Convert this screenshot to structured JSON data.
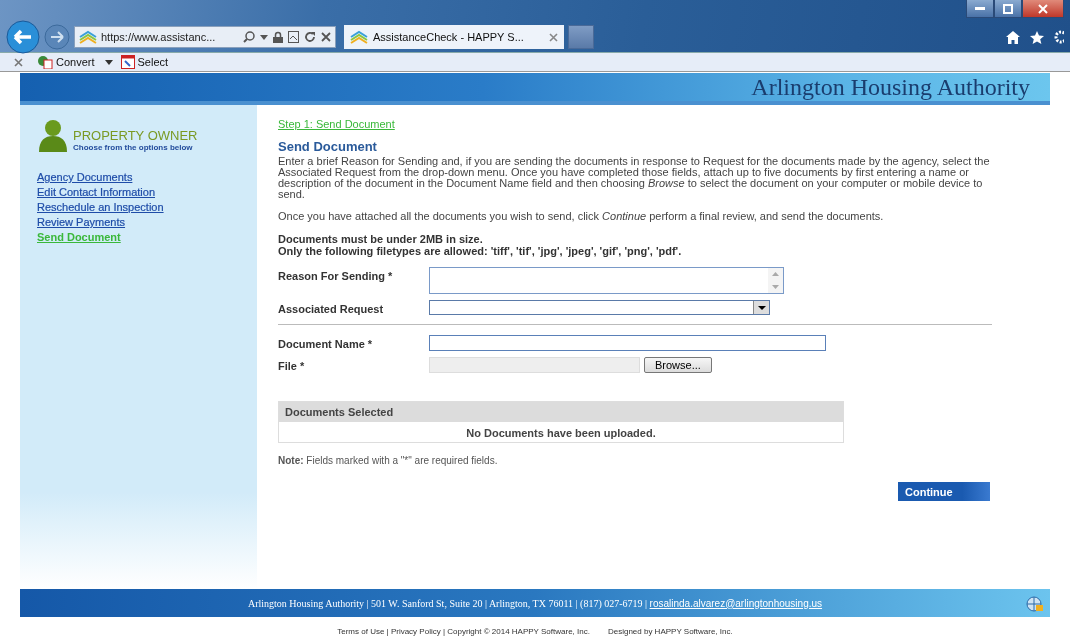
{
  "browser": {
    "address": "https://www.assistanc...",
    "tabs": [
      {
        "title": "AssistanceCheck - HAPPY S...",
        "selected": true
      }
    ],
    "toolbar": [
      {
        "label": "Convert",
        "kind": "dropdown"
      },
      {
        "label": "Select",
        "kind": "plain"
      }
    ]
  },
  "header": {
    "title": "Arlington Housing Authority"
  },
  "sidebar": {
    "role": "PROPERTY OWNER",
    "hint": "Choose from the options below",
    "items": [
      {
        "label": "Agency Documents",
        "selected": false
      },
      {
        "label": "Edit Contact Information",
        "selected": false
      },
      {
        "label": "Reschedule an Inspection",
        "selected": false
      },
      {
        "label": "Review Payments",
        "selected": false
      },
      {
        "label": "Send Document",
        "selected": true
      }
    ]
  },
  "main": {
    "breadcrumb": "Step 1: Send Document",
    "heading": "Send Document",
    "paragraphs": [
      "Enter a brief Reason for Sending and, if you are sending the documents in response to Request for the documents made by the agency, select the Associated Request from the drop-down menu. Once you have completed those fields, attach up to five documents by first entering a name or description of the document in the Document Name field and then choosing *Browse* to select the document on your computer or mobile device to send.",
      "Once you have attached all the documents you wish to send, click *Continue* perform a final review, and send the documents."
    ],
    "rules": [
      "Documents must be under 2MB in size.",
      "Only the following filetypes are allowed: 'tiff', 'tif', 'jpg', 'jpeg', 'gif', 'png', 'pdf'."
    ],
    "form_sections": [
      [
        {
          "label": "Reason For Sending *",
          "kind": "textarea"
        },
        {
          "label": "Associated Request",
          "kind": "select"
        }
      ],
      [
        {
          "label": "Document Name *",
          "kind": "text"
        },
        {
          "label": "File *",
          "kind": "file",
          "button": "Browse..."
        }
      ]
    ],
    "documents_table": {
      "title": "Documents Selected",
      "empty_message": "No Documents have been uploaded."
    },
    "note": "**Note:** Fields marked with a \"*\" are required fields.",
    "continue_button": "Continue"
  },
  "footer": {
    "address": "Arlington Housing Authority | 501 W. Sanford St, Suite 20 | Arlington, TX 76011 | (817) 027-6719 |",
    "email": "rosalinda.alvarez@arlingtonhousing.us"
  },
  "bottom": {
    "legal": "Terms of Use | Privacy Policy | Copyright © 2014 HAPPY Software, Inc.",
    "credit": "Designed by HAPPY Software, Inc."
  }
}
